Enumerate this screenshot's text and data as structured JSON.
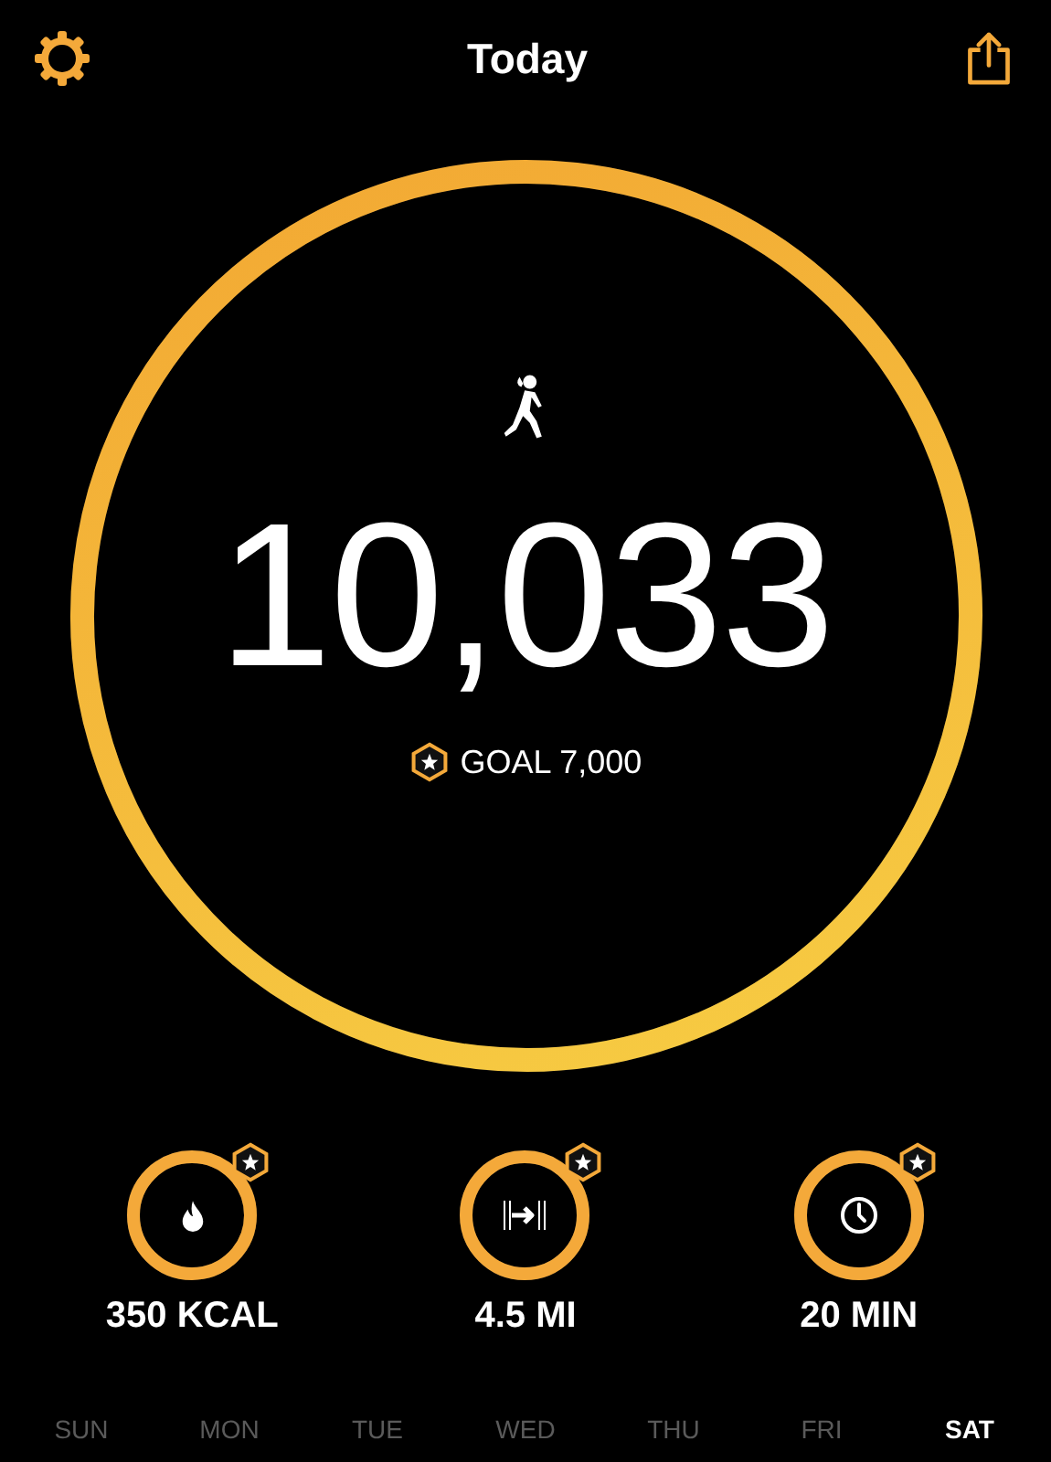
{
  "header": {
    "title": "Today"
  },
  "steps": {
    "value": "10,033",
    "level": 1,
    "goal": "GOAL 7,000"
  },
  "metrics": [
    {
      "kind": "calories",
      "value": "350 KCAL",
      "level": 1
    },
    {
      "kind": "distance",
      "value": "4.5 MI",
      "level": 1
    },
    {
      "kind": "time",
      "value": "20 MIN",
      "level": 1
    }
  ],
  "days": [
    {
      "label": "SUN",
      "selected": false
    },
    {
      "label": "MON",
      "selected": false
    },
    {
      "label": "TUE",
      "selected": false
    },
    {
      "label": "WED",
      "selected": false
    },
    {
      "label": "THU",
      "selected": false
    },
    {
      "label": "FRI",
      "selected": false
    },
    {
      "label": "SAT",
      "selected": true
    }
  ]
}
